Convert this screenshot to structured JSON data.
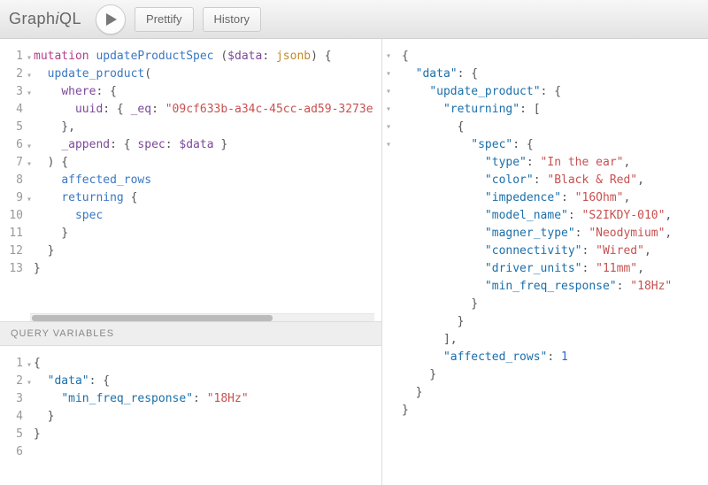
{
  "toolbar": {
    "logo_plain1": "Graph",
    "logo_italic": "i",
    "logo_plain2": "QL",
    "prettify": "Prettify",
    "history": "History"
  },
  "vars_header": "Query Variables",
  "query": {
    "lines": [
      [
        {
          "c": "k-mut",
          "t": "mutation"
        },
        {
          "c": "p",
          "t": " "
        },
        {
          "c": "k-name",
          "t": "updateProductSpec"
        },
        {
          "c": "p",
          "t": " ("
        },
        {
          "c": "k-var",
          "t": "$data"
        },
        {
          "c": "p",
          "t": ": "
        },
        {
          "c": "k-type",
          "t": "jsonb"
        },
        {
          "c": "p",
          "t": ") {"
        }
      ],
      [
        {
          "c": "p",
          "t": "  "
        },
        {
          "c": "k-field",
          "t": "update_product"
        },
        {
          "c": "p",
          "t": "("
        }
      ],
      [
        {
          "c": "p",
          "t": "    "
        },
        {
          "c": "k-arg",
          "t": "where"
        },
        {
          "c": "p",
          "t": ": {"
        }
      ],
      [
        {
          "c": "p",
          "t": "      "
        },
        {
          "c": "k-arg",
          "t": "uuid"
        },
        {
          "c": "p",
          "t": ": { "
        },
        {
          "c": "k-arg",
          "t": "_eq"
        },
        {
          "c": "p",
          "t": ": "
        },
        {
          "c": "k-str",
          "t": "\"09cf633b-a34c-45cc-ad59-3273e"
        }
      ],
      [
        {
          "c": "p",
          "t": "    },"
        }
      ],
      [
        {
          "c": "p",
          "t": "    "
        },
        {
          "c": "k-arg",
          "t": "_append"
        },
        {
          "c": "p",
          "t": ": { "
        },
        {
          "c": "k-arg",
          "t": "spec"
        },
        {
          "c": "p",
          "t": ": "
        },
        {
          "c": "k-var",
          "t": "$data"
        },
        {
          "c": "p",
          "t": " }"
        }
      ],
      [
        {
          "c": "p",
          "t": "  ) {"
        }
      ],
      [
        {
          "c": "p",
          "t": "    "
        },
        {
          "c": "k-field",
          "t": "affected_rows"
        }
      ],
      [
        {
          "c": "p",
          "t": "    "
        },
        {
          "c": "k-field",
          "t": "returning"
        },
        {
          "c": "p",
          "t": " {"
        }
      ],
      [
        {
          "c": "p",
          "t": "      "
        },
        {
          "c": "k-field",
          "t": "spec"
        }
      ],
      [
        {
          "c": "p",
          "t": "    }"
        }
      ],
      [
        {
          "c": "p",
          "t": "  }"
        }
      ],
      [
        {
          "c": "p",
          "t": "}"
        }
      ]
    ],
    "line_numbers": [
      "1",
      "2",
      "3",
      "4",
      "5",
      "6",
      "7",
      "8",
      "9",
      "10",
      "11",
      "12",
      "13"
    ],
    "folds": {
      "1": "▾",
      "2": "▾",
      "3": "▾",
      "6": "▾",
      "7": "▾",
      "9": "▾"
    }
  },
  "vars": {
    "lines": [
      [
        {
          "c": "p",
          "t": "{"
        }
      ],
      [
        {
          "c": "p",
          "t": "  "
        },
        {
          "c": "k-key",
          "t": "\"data\""
        },
        {
          "c": "p",
          "t": ": {"
        }
      ],
      [
        {
          "c": "p",
          "t": "    "
        },
        {
          "c": "k-key",
          "t": "\"min_freq_response\""
        },
        {
          "c": "p",
          "t": ": "
        },
        {
          "c": "k-str",
          "t": "\"18Hz\""
        }
      ],
      [
        {
          "c": "p",
          "t": "  }"
        }
      ],
      [
        {
          "c": "p",
          "t": "}"
        }
      ],
      [
        {
          "c": "p",
          "t": " "
        }
      ]
    ],
    "line_numbers": [
      "1",
      "2",
      "3",
      "4",
      "5",
      "6"
    ],
    "folds": {
      "1": "▾",
      "2": "▾"
    }
  },
  "result": {
    "lines": [
      [
        {
          "c": "p",
          "t": "{"
        }
      ],
      [
        {
          "c": "p",
          "t": "  "
        },
        {
          "c": "k-key",
          "t": "\"data\""
        },
        {
          "c": "p",
          "t": ": {"
        }
      ],
      [
        {
          "c": "p",
          "t": "    "
        },
        {
          "c": "k-key",
          "t": "\"update_product\""
        },
        {
          "c": "p",
          "t": ": {"
        }
      ],
      [
        {
          "c": "p",
          "t": "      "
        },
        {
          "c": "k-key",
          "t": "\"returning\""
        },
        {
          "c": "p",
          "t": ": ["
        }
      ],
      [
        {
          "c": "p",
          "t": "        {"
        }
      ],
      [
        {
          "c": "p",
          "t": "          "
        },
        {
          "c": "k-key",
          "t": "\"spec\""
        },
        {
          "c": "p",
          "t": ": {"
        }
      ],
      [
        {
          "c": "p",
          "t": "            "
        },
        {
          "c": "k-key",
          "t": "\"type\""
        },
        {
          "c": "p",
          "t": ": "
        },
        {
          "c": "k-str",
          "t": "\"In the ear\""
        },
        {
          "c": "p",
          "t": ","
        }
      ],
      [
        {
          "c": "p",
          "t": "            "
        },
        {
          "c": "k-key",
          "t": "\"color\""
        },
        {
          "c": "p",
          "t": ": "
        },
        {
          "c": "k-str",
          "t": "\"Black & Red\""
        },
        {
          "c": "p",
          "t": ","
        }
      ],
      [
        {
          "c": "p",
          "t": "            "
        },
        {
          "c": "k-key",
          "t": "\"impedence\""
        },
        {
          "c": "p",
          "t": ": "
        },
        {
          "c": "k-str",
          "t": "\"16Ohm\""
        },
        {
          "c": "p",
          "t": ","
        }
      ],
      [
        {
          "c": "p",
          "t": "            "
        },
        {
          "c": "k-key",
          "t": "\"model_name\""
        },
        {
          "c": "p",
          "t": ": "
        },
        {
          "c": "k-str",
          "t": "\"S2IKDY-010\""
        },
        {
          "c": "p",
          "t": ","
        }
      ],
      [
        {
          "c": "p",
          "t": "            "
        },
        {
          "c": "k-key",
          "t": "\"magner_type\""
        },
        {
          "c": "p",
          "t": ": "
        },
        {
          "c": "k-str",
          "t": "\"Neodymium\""
        },
        {
          "c": "p",
          "t": ","
        }
      ],
      [
        {
          "c": "p",
          "t": "            "
        },
        {
          "c": "k-key",
          "t": "\"connectivity\""
        },
        {
          "c": "p",
          "t": ": "
        },
        {
          "c": "k-str",
          "t": "\"Wired\""
        },
        {
          "c": "p",
          "t": ","
        }
      ],
      [
        {
          "c": "p",
          "t": "            "
        },
        {
          "c": "k-key",
          "t": "\"driver_units\""
        },
        {
          "c": "p",
          "t": ": "
        },
        {
          "c": "k-str",
          "t": "\"11mm\""
        },
        {
          "c": "p",
          "t": ","
        }
      ],
      [
        {
          "c": "p",
          "t": "            "
        },
        {
          "c": "k-key",
          "t": "\"min_freq_response\""
        },
        {
          "c": "p",
          "t": ": "
        },
        {
          "c": "k-str",
          "t": "\"18Hz\""
        }
      ],
      [
        {
          "c": "p",
          "t": "          }"
        }
      ],
      [
        {
          "c": "p",
          "t": "        }"
        }
      ],
      [
        {
          "c": "p",
          "t": "      ],"
        }
      ],
      [
        {
          "c": "p",
          "t": "      "
        },
        {
          "c": "k-key",
          "t": "\"affected_rows\""
        },
        {
          "c": "p",
          "t": ": "
        },
        {
          "c": "k-num",
          "t": "1"
        }
      ],
      [
        {
          "c": "p",
          "t": "    }"
        }
      ],
      [
        {
          "c": "p",
          "t": "  }"
        }
      ],
      [
        {
          "c": "p",
          "t": "}"
        }
      ]
    ],
    "folds": {
      "1": "▾",
      "2": "▾",
      "3": "▾",
      "4": "▾",
      "5": "▾",
      "6": "▾"
    }
  }
}
